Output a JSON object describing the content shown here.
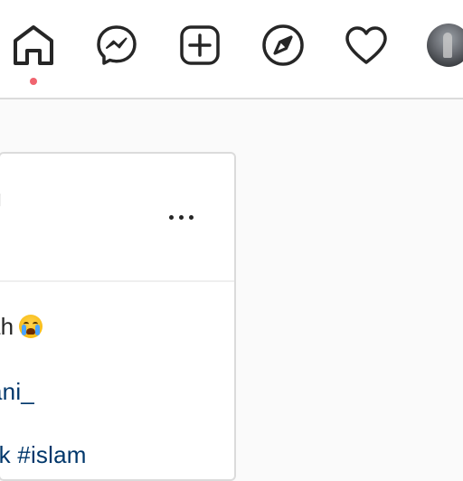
{
  "nav": {
    "icons": [
      "home-icon",
      "messenger-icon",
      "new-post-icon",
      "explore-icon",
      "heart-icon",
      "profile-avatar"
    ],
    "active_item": "home",
    "active_dot_color": "#ed4956"
  },
  "post": {
    "username_fragment": "g",
    "more_icon": "more-options-icon",
    "caption": {
      "line1_text": "ah",
      "line1_emoji": "loudly-crying-face",
      "line2_link": "ani_",
      "line3_link": "ak #islam"
    }
  },
  "colors": {
    "link": "#00376b",
    "text": "#262626",
    "border": "#dbdbdb",
    "background": "#fafafa"
  }
}
